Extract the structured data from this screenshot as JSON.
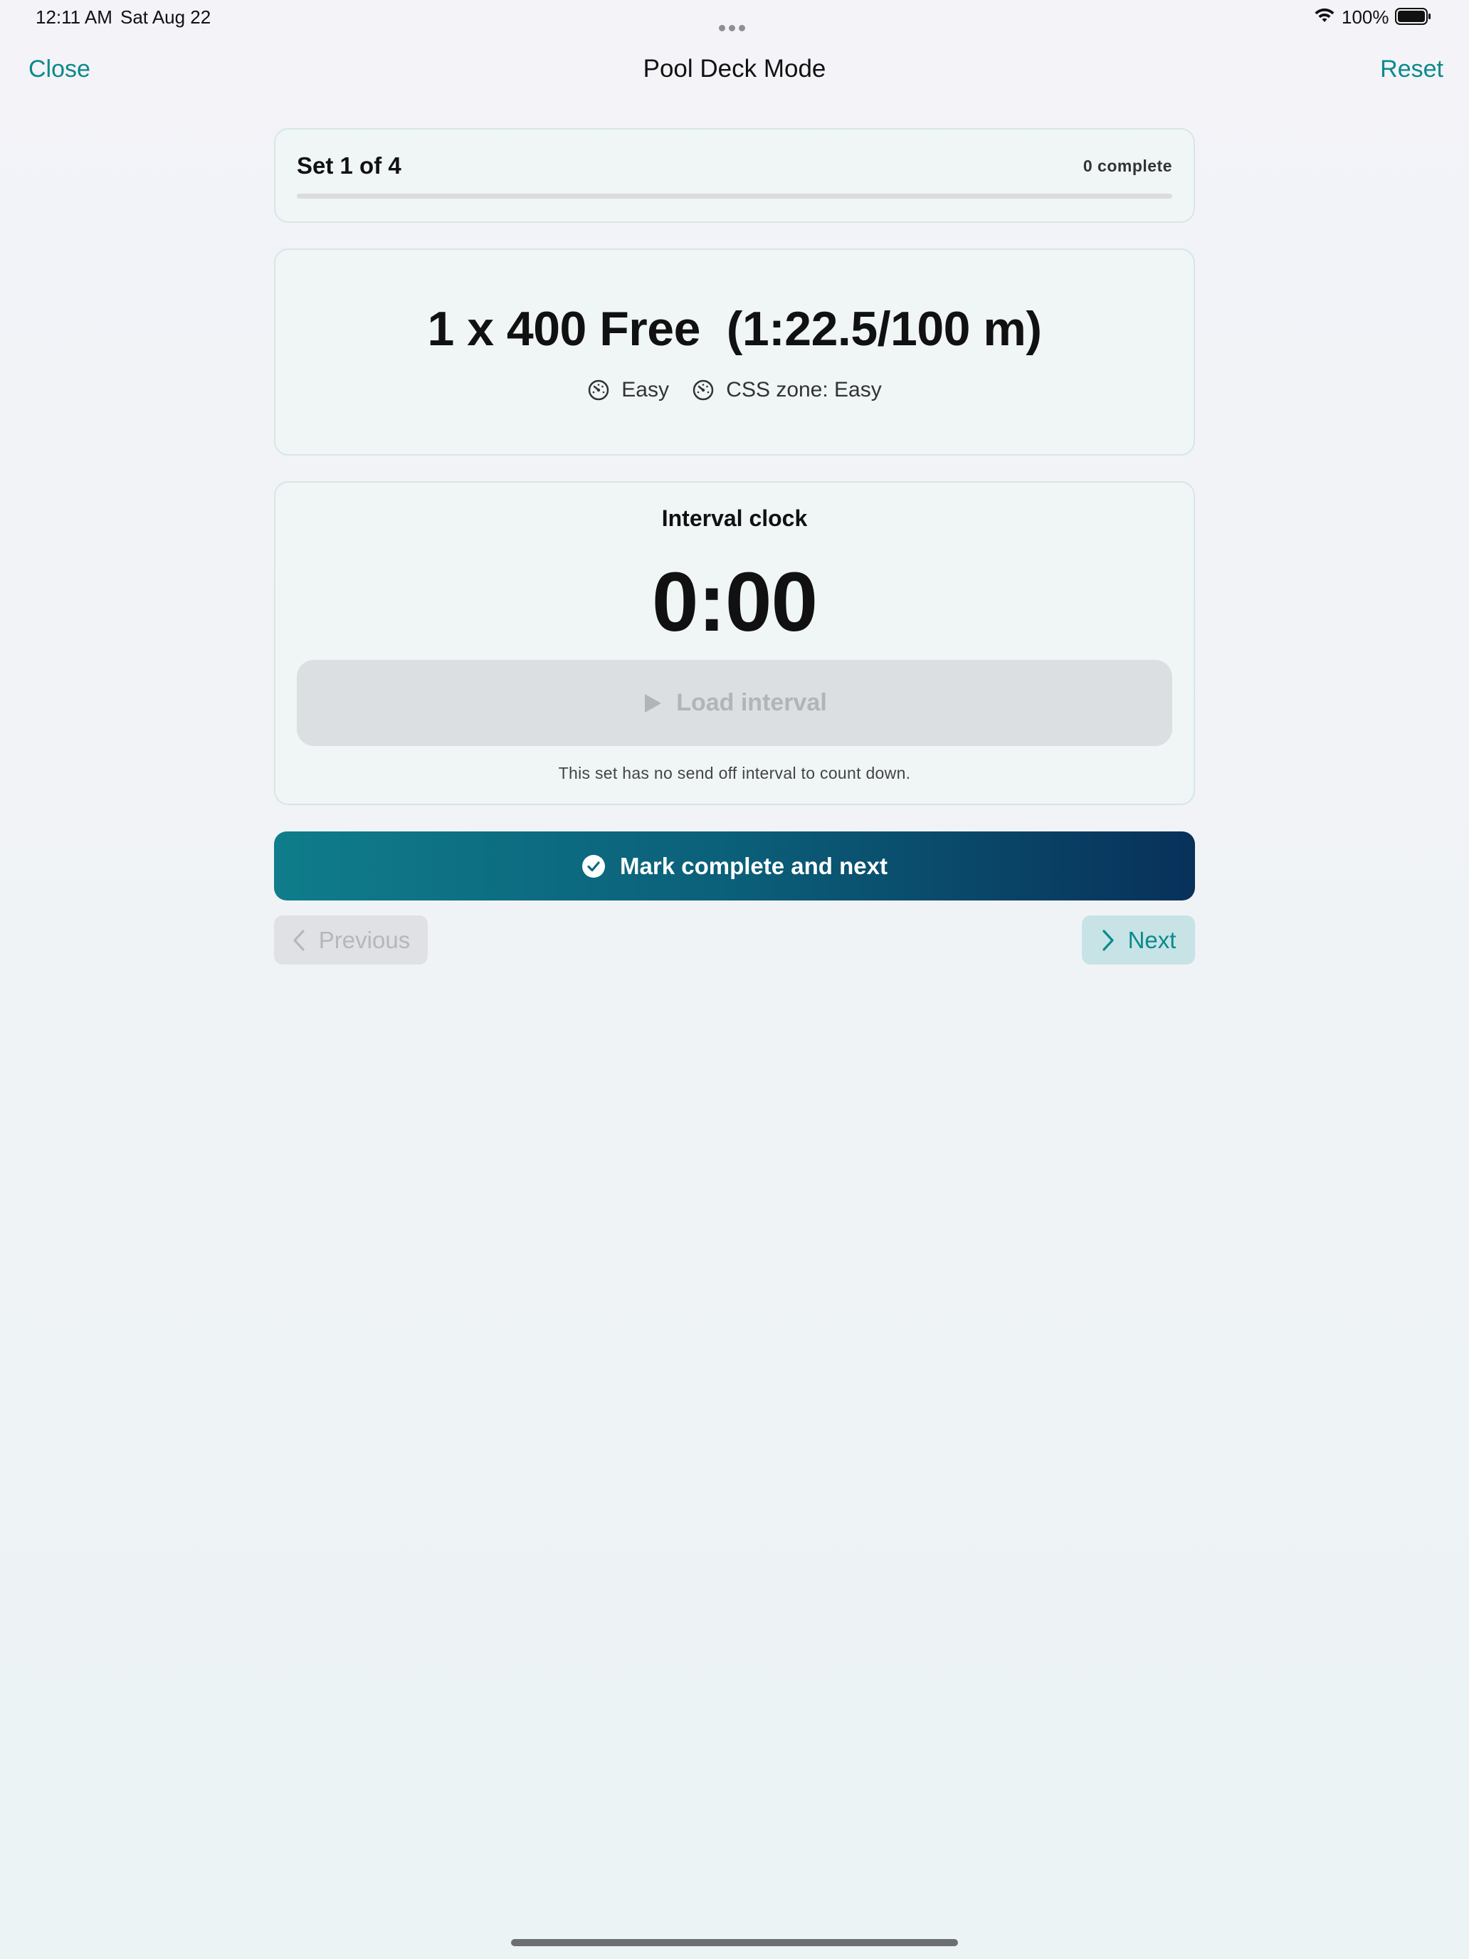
{
  "status_bar": {
    "time": "12:11 AM",
    "date": "Sat Aug 22",
    "battery_percent": "100%",
    "icons": [
      "more-dots-icon",
      "wifi-icon",
      "battery-icon"
    ]
  },
  "nav": {
    "close_label": "Close",
    "title": "Pool Deck Mode",
    "reset_label": "Reset"
  },
  "progress": {
    "set_label": "Set 1 of 4",
    "complete_label": "0 complete",
    "fraction": 0
  },
  "set": {
    "title": "1 x 400 Free  (1:22.5/100 m)",
    "effort": "Easy",
    "css_zone": "CSS zone: Easy",
    "icons": [
      "speedometer-icon",
      "speedometer-icon"
    ]
  },
  "clock": {
    "heading": "Interval clock",
    "value": "0:00",
    "load_label": "Load interval",
    "note": "This set has no send off interval to count down."
  },
  "actions": {
    "mark_label": "Mark complete and next",
    "previous_label": "Previous",
    "next_label": "Next"
  },
  "colors": {
    "accent": "#0a8a8c",
    "gradient_start": "#0f7d8b",
    "gradient_end": "#08315a",
    "card_bg": "#eff6f5",
    "disabled_bg": "#dcdfe1"
  }
}
